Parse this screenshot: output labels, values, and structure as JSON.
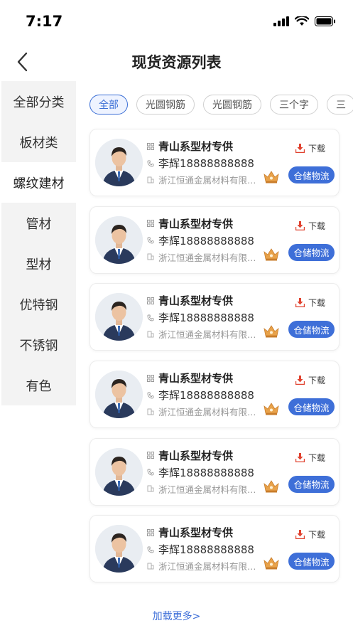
{
  "status_bar": {
    "time": "7:17"
  },
  "header": {
    "title": "现货资源列表"
  },
  "sidebar": {
    "items": [
      {
        "label": "全部分类"
      },
      {
        "label": "板材类"
      },
      {
        "label": "螺纹建材"
      },
      {
        "label": "管材"
      },
      {
        "label": "型材"
      },
      {
        "label": "优特钢"
      },
      {
        "label": "不锈钢"
      },
      {
        "label": "有色"
      }
    ],
    "active_index": 2
  },
  "filters": {
    "chips": [
      {
        "label": "全部"
      },
      {
        "label": "光圆钢筋"
      },
      {
        "label": "光圆钢筋"
      },
      {
        "label": "三个字"
      },
      {
        "label": "三"
      }
    ],
    "active_index": 0
  },
  "cards": [
    {
      "name": "青山系型材专供",
      "phone": "李辉18888888888",
      "company": "浙江恒通金属材料有限公...",
      "download_label": "下载",
      "button_label": "仓储物流"
    },
    {
      "name": "青山系型材专供",
      "phone": "李辉18888888888",
      "company": "浙江恒通金属材料有限公...",
      "download_label": "下载",
      "button_label": "仓储物流"
    },
    {
      "name": "青山系型材专供",
      "phone": "李辉18888888888",
      "company": "浙江恒通金属材料有限公...",
      "download_label": "下载",
      "button_label": "仓储物流"
    },
    {
      "name": "青山系型材专供",
      "phone": "李辉18888888888",
      "company": "浙江恒通金属材料有限公...",
      "download_label": "下载",
      "button_label": "仓储物流"
    },
    {
      "name": "青山系型材专供",
      "phone": "李辉18888888888",
      "company": "浙江恒通金属材料有限公...",
      "download_label": "下载",
      "button_label": "仓储物流"
    },
    {
      "name": "青山系型材专供",
      "phone": "李辉18888888888",
      "company": "浙江恒通金属材料有限公...",
      "download_label": "下载",
      "button_label": "仓储物流"
    }
  ],
  "footer": {
    "load_more": "加载更多>"
  },
  "colors": {
    "accent": "#3e6fd8",
    "download_red": "#e0422f",
    "crown": "#e8a24a"
  }
}
